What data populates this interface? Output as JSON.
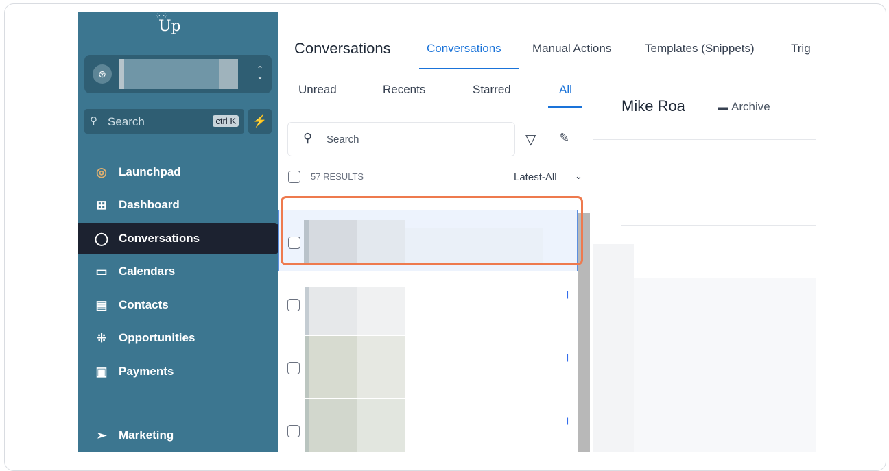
{
  "sidebar": {
    "logo_text": "Up",
    "search": {
      "placeholder": "Search",
      "shortcut": "ctrl K"
    },
    "items": [
      {
        "label": "Launchpad",
        "icon": "launchpad-icon"
      },
      {
        "label": "Dashboard",
        "icon": "dashboard-icon"
      },
      {
        "label": "Conversations",
        "icon": "chat-icon",
        "active": true
      },
      {
        "label": "Calendars",
        "icon": "calendar-icon"
      },
      {
        "label": "Contacts",
        "icon": "contacts-icon"
      },
      {
        "label": "Opportunities",
        "icon": "opportunities-icon"
      },
      {
        "label": "Payments",
        "icon": "payments-icon"
      },
      {
        "label": "Marketing",
        "icon": "send-icon"
      }
    ]
  },
  "header": {
    "title": "Conversations",
    "tabs": [
      {
        "label": "Conversations",
        "active": true
      },
      {
        "label": "Manual Actions"
      },
      {
        "label": "Templates (Snippets)"
      },
      {
        "label": "Trig"
      }
    ]
  },
  "list": {
    "tabs": [
      {
        "label": "Unread"
      },
      {
        "label": "Recents"
      },
      {
        "label": "Starred"
      },
      {
        "label": "All",
        "active": true
      }
    ],
    "search_placeholder": "Search",
    "results_count": "57 RESULTS",
    "sort_label": "Latest-All"
  },
  "detail": {
    "contact_name": "Mike Roa",
    "archive_label": "Archive"
  },
  "colors": {
    "sidebar_bg": "#3c7690",
    "active_nav_bg": "#1c2230",
    "accent": "#1a73d9",
    "highlight": "#ee7a4e"
  }
}
